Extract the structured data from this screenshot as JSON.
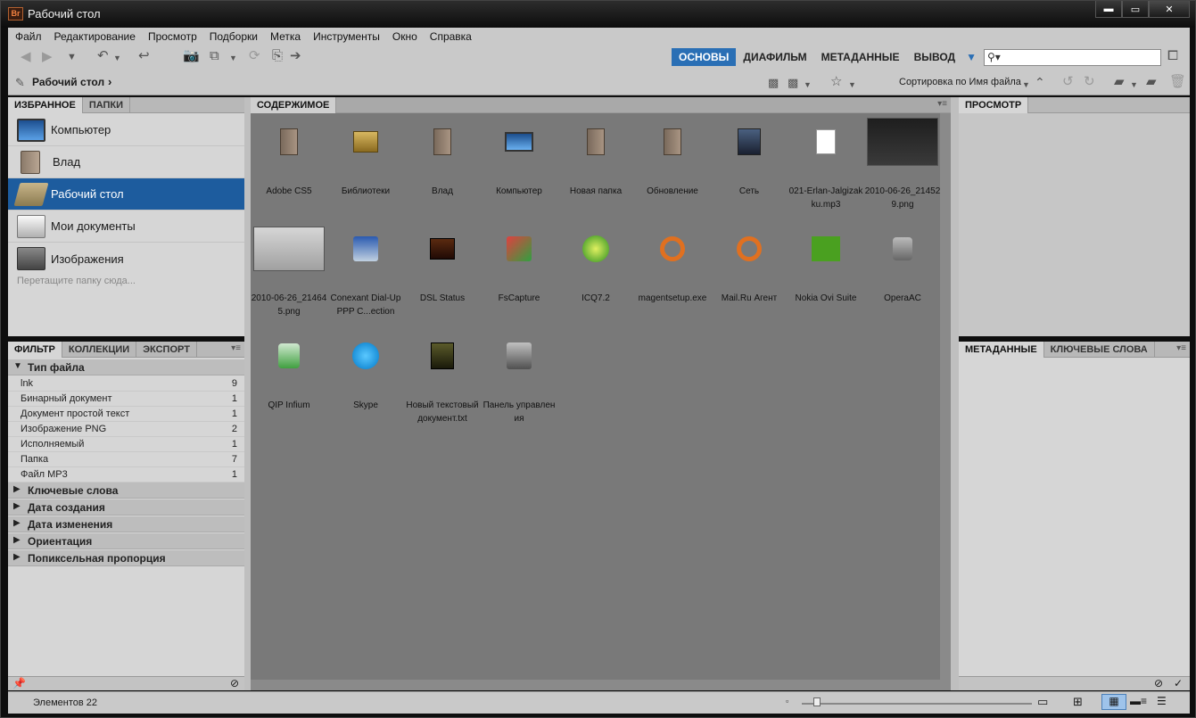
{
  "window": {
    "title": "Рабочий стол",
    "app_logo": "Br",
    "minimize_icon": "minimize-icon",
    "maximize_icon": "maximize-icon",
    "close_icon": "close-icon"
  },
  "menu": [
    "Файл",
    "Редактирование",
    "Просмотр",
    "Подборки",
    "Метка",
    "Инструменты",
    "Окно",
    "Справка"
  ],
  "workspaces": {
    "items": [
      "ОСНОВЫ",
      "ДИАФИЛЬМ",
      "МЕТАДАННЫЕ",
      "ВЫВОД"
    ],
    "active": "ОСНОВЫ"
  },
  "search": {
    "placeholder": "",
    "icon": "search-icon"
  },
  "path": {
    "current": "Рабочий стол"
  },
  "sort": {
    "label": "Сортировка по Имя файла"
  },
  "left_top_panel": {
    "tabs": [
      "ИЗБРАННОЕ",
      "ПАПКИ"
    ],
    "favorites": [
      {
        "label": "Компьютер",
        "icon": "computer-icon"
      },
      {
        "label": "Влад",
        "icon": "user-folder-icon"
      },
      {
        "label": "Рабочий стол",
        "icon": "desktop-icon",
        "selected": true
      },
      {
        "label": "Мои документы",
        "icon": "documents-icon"
      },
      {
        "label": "Изображения",
        "icon": "pictures-icon"
      }
    ],
    "drop_hint": "Перетащите папку сюда..."
  },
  "left_bottom_panel": {
    "tabs": [
      "ФИЛЬТР",
      "КОЛЛЕКЦИИ",
      "ЭКСПОРТ"
    ],
    "file_type_header": "Тип файла",
    "file_types": [
      {
        "name": "lnk",
        "count": "9"
      },
      {
        "name": "Бинарный документ",
        "count": "1"
      },
      {
        "name": "Документ простой текст",
        "count": "1"
      },
      {
        "name": "Изображение PNG",
        "count": "2"
      },
      {
        "name": "Исполняемый",
        "count": "1"
      },
      {
        "name": "Папка",
        "count": "7"
      },
      {
        "name": "Файл MP3",
        "count": "1"
      }
    ],
    "collapsed_sections": [
      "Ключевые слова",
      "Дата создания",
      "Дата изменения",
      "Ориентация",
      "Попиксельная пропорция"
    ]
  },
  "content": {
    "tab": "СОДЕРЖИМОЕ",
    "items": [
      {
        "name": "Adobe CS5",
        "kind": "folder"
      },
      {
        "name": "Библиотеки",
        "kind": "library"
      },
      {
        "name": "Влад",
        "kind": "folder"
      },
      {
        "name": "Компьютер",
        "kind": "computer"
      },
      {
        "name": "Новая папка",
        "kind": "folder"
      },
      {
        "name": "Обновление",
        "kind": "folder"
      },
      {
        "name": "Сеть",
        "kind": "network"
      },
      {
        "name": "021-Erlan-Jalgizakku.mp3",
        "kind": "mp3"
      },
      {
        "name": "2010-06-26_214529.png",
        "kind": "screenshot-dark"
      },
      {
        "name": "2010-06-26_214645.png",
        "kind": "screenshot-light"
      },
      {
        "name": "Conexant Dial-Up PPP C...ection",
        "kind": "shortcut-modem"
      },
      {
        "name": "DSL Status",
        "kind": "shortcut-dsl"
      },
      {
        "name": "FsCapture",
        "kind": "shortcut-fscapture"
      },
      {
        "name": "ICQ7.2",
        "kind": "shortcut-icq"
      },
      {
        "name": "magentsetup.exe",
        "kind": "exe-mail"
      },
      {
        "name": "Mail.Ru Агент",
        "kind": "shortcut-mail"
      },
      {
        "name": "Nokia Ovi Suite",
        "kind": "shortcut-ovi"
      },
      {
        "name": "OperaAC",
        "kind": "shortcut-opera"
      },
      {
        "name": "QIP Infium",
        "kind": "shortcut-qip"
      },
      {
        "name": "Skype",
        "kind": "shortcut-skype"
      },
      {
        "name": "Новый текстовый документ.txt",
        "kind": "txt"
      },
      {
        "name": "Панель управления",
        "kind": "shortcut-control"
      }
    ]
  },
  "right_top_panel": {
    "tabs": [
      "ПРОСМОТР"
    ]
  },
  "right_bottom_panel": {
    "tabs": [
      "МЕТАДАННЫЕ",
      "КЛЮЧЕВЫЕ СЛОВА"
    ]
  },
  "status": {
    "items_count": "Элементов 22"
  },
  "colors": {
    "selection": "#1d5c9e",
    "workspace_active": "#2a6fb5",
    "content_bg": "#797979",
    "panel_bg": "#d6d6d6"
  }
}
